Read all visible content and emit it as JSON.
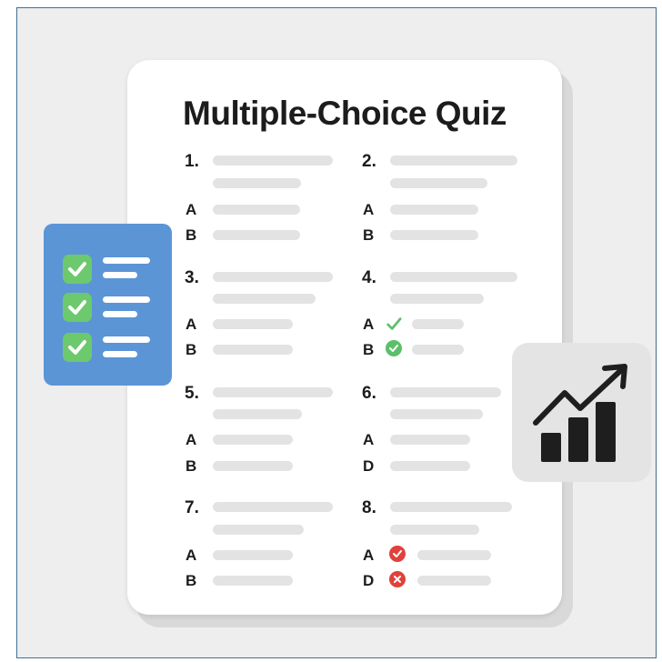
{
  "quiz": {
    "title": "Multiple-Choice Quiz",
    "questions": [
      {
        "number": "1.",
        "options": [
          {
            "letter": "A",
            "mark": "none"
          },
          {
            "letter": "B",
            "mark": "none"
          }
        ]
      },
      {
        "number": "2.",
        "options": [
          {
            "letter": "A",
            "mark": "none"
          },
          {
            "letter": "B",
            "mark": "none"
          }
        ]
      },
      {
        "number": "3.",
        "options": [
          {
            "letter": "A",
            "mark": "none"
          },
          {
            "letter": "B",
            "mark": "none"
          }
        ]
      },
      {
        "number": "4.",
        "options": [
          {
            "letter": "A",
            "mark": "check"
          },
          {
            "letter": "B",
            "mark": "check-circle"
          }
        ]
      },
      {
        "number": "5.",
        "options": [
          {
            "letter": "A",
            "mark": "none"
          },
          {
            "letter": "B",
            "mark": "none"
          }
        ]
      },
      {
        "number": "6.",
        "options": [
          {
            "letter": "A",
            "mark": "none"
          },
          {
            "letter": "D",
            "mark": "none"
          }
        ]
      },
      {
        "number": "7.",
        "options": [
          {
            "letter": "A",
            "mark": "none"
          },
          {
            "letter": "B",
            "mark": "none"
          }
        ]
      },
      {
        "number": "8.",
        "options": [
          {
            "letter": "A",
            "mark": "check-circle-red"
          },
          {
            "letter": "D",
            "mark": "cross-circle-red"
          }
        ]
      }
    ]
  },
  "checklist_card": {
    "icon": "checklist-icon",
    "items": 3,
    "color": "#5b95d6",
    "check_color": "#6dc96d"
  },
  "chart_card": {
    "icon": "growth-chart-icon"
  },
  "colors": {
    "correct": "#5cbf6a",
    "incorrect": "#e0413b",
    "placeholder_bar": "#e3e3e3"
  }
}
